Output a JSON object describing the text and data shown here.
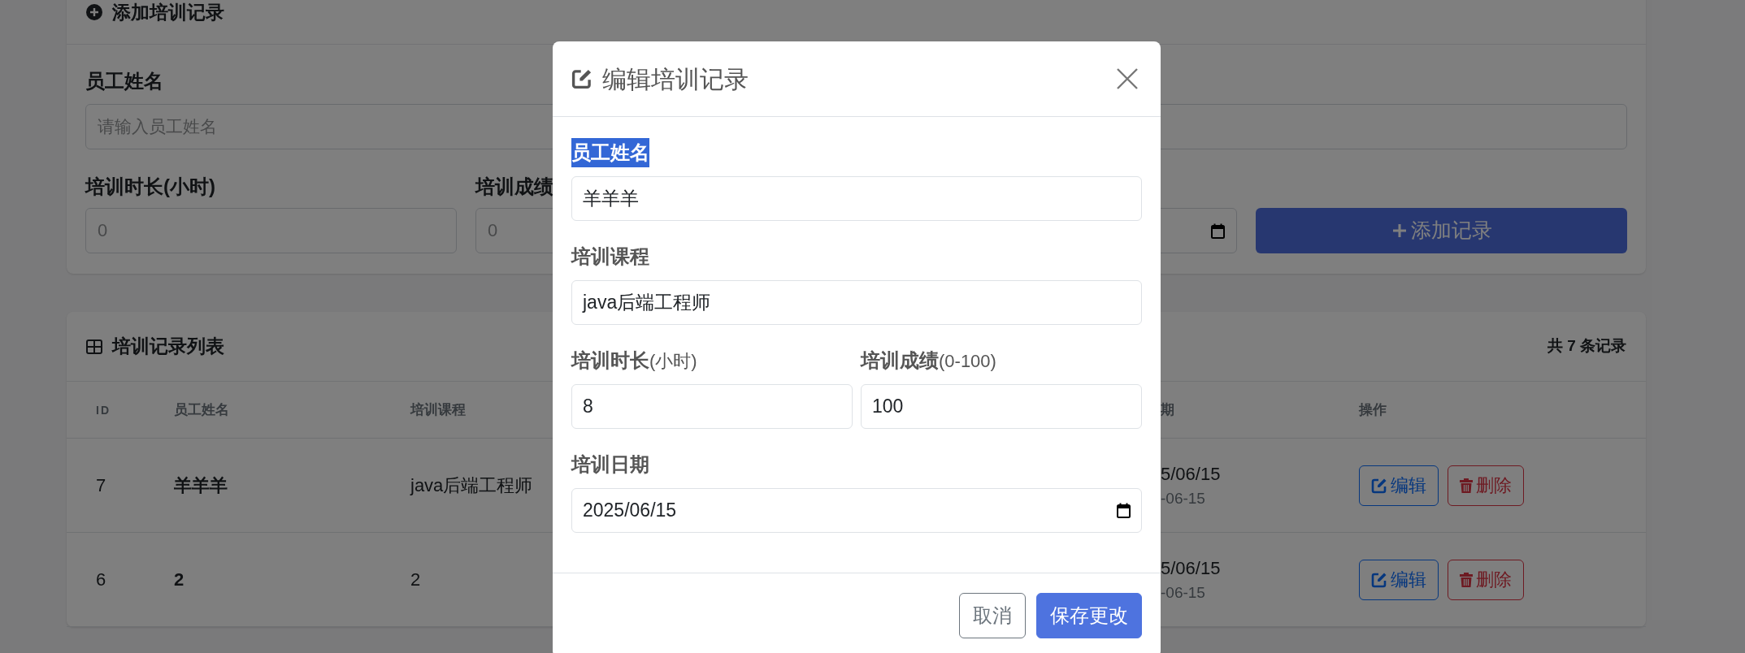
{
  "add_form": {
    "title": "添加培训记录",
    "fields": [
      {
        "label": "员工姓名",
        "placeholder": "请输入员工姓名"
      },
      {
        "label": "培训时长(小时)",
        "placeholder": "0"
      },
      {
        "label": "培训成绩",
        "placeholder": "0"
      }
    ],
    "add_button": "添加记录"
  },
  "records": {
    "title": "培训记录列表",
    "total": "共 7 条记录",
    "columns": [
      "ID",
      "员工姓名",
      "培训课程",
      "期",
      "操作"
    ],
    "rows": [
      {
        "id": "7",
        "name": "羊羊羊",
        "course": "java后端工程师",
        "date": "5/06/15",
        "date_sub": "-06-15",
        "edit": "编辑",
        "delete": "删除"
      },
      {
        "id": "6",
        "name": "2",
        "course": "2",
        "date": "5/06/15",
        "date_sub": "-06-15",
        "edit": "编辑",
        "delete": "删除"
      }
    ]
  },
  "modal": {
    "title": "编辑培训记录",
    "fields": [
      {
        "kind": "text",
        "label": "员工姓名",
        "value": "羊羊羊",
        "highlighted": true
      },
      {
        "kind": "text",
        "label": "培训课程",
        "value": "java后端工程师",
        "highlighted": false
      },
      {
        "kind": "pair",
        "items": [
          {
            "label": "培训时长",
            "hint": "(小时)",
            "value": "8",
            "highlighted": false
          },
          {
            "label": "培训成绩",
            "hint": "(0-100)",
            "value": "100",
            "highlighted": false
          }
        ]
      },
      {
        "kind": "date",
        "label": "培训日期",
        "value": "2025/06/15",
        "highlighted": false
      }
    ],
    "buttons": [
      {
        "kind": "secondary",
        "label": "取消"
      },
      {
        "kind": "primary",
        "label": "保存更改"
      }
    ]
  }
}
